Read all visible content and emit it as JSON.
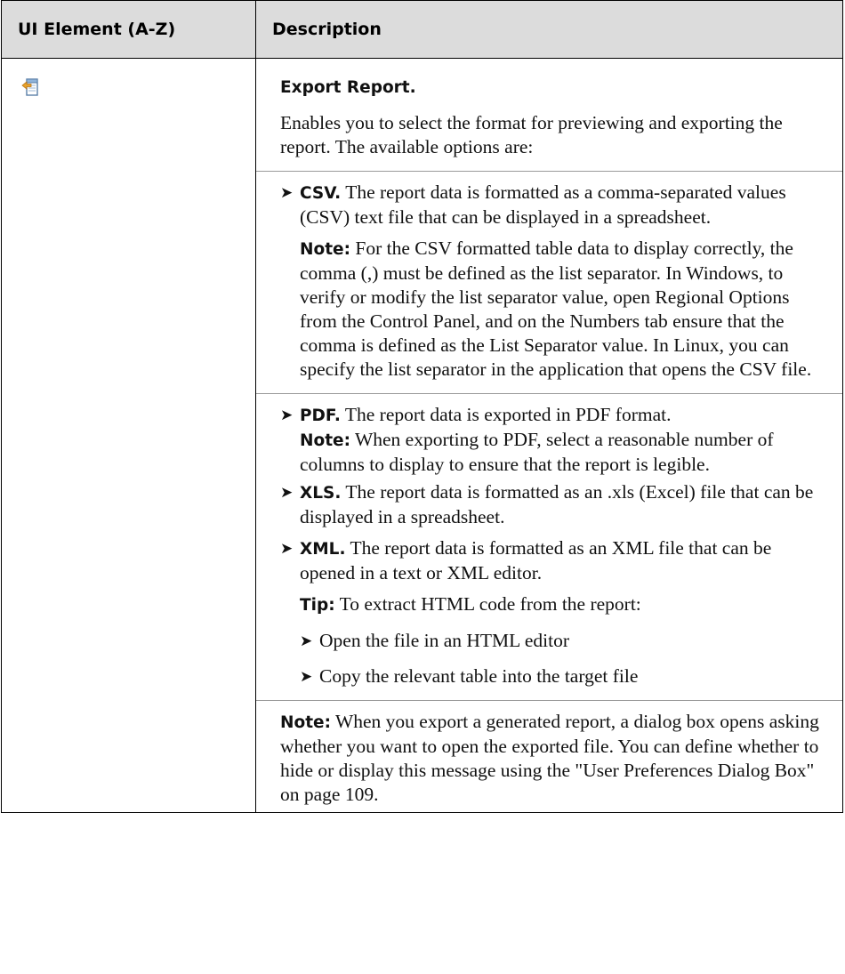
{
  "header": {
    "col1": "UI Element (A-Z)",
    "col2": "Description"
  },
  "row": {
    "icon": "export-report-icon",
    "title": "Export Report.",
    "intro": "Enables you to select the format for previewing and exporting the report. The available options are:",
    "csv_label": "CSV.",
    "csv_text": " The report data is formatted as a comma-separated values (CSV) text file that can be displayed in a spreadsheet.",
    "csv_note_label": "Note:",
    "csv_note_text": " For the CSV formatted table data to display correctly, the comma (,) must be defined as the list separator. In Windows, to verify or modify the list separator value, open Regional Options from the Control Panel, and on the Numbers tab ensure that the comma is defined as the List Separator value. In Linux, you can specify the list separator in the application that opens the CSV file.",
    "pdf_label": "PDF.",
    "pdf_text": " The report data is exported in PDF format.",
    "pdf_note_label": "Note:",
    "pdf_note_text": " When exporting to PDF, select a reasonable number of columns to display to ensure that the report is legible.",
    "xls_label": "XLS.",
    "xls_text": " The report data is formatted as an .xls (Excel) file that can be displayed in a spreadsheet.",
    "xml_label": "XML.",
    "xml_text": " The report data is formatted as an XML file that can be opened in a text or XML editor.",
    "tip_label": "Tip:",
    "tip_text": " To extract HTML code from the report:",
    "tip_steps": [
      "Open the file in an HTML editor",
      "Copy the relevant table into the target file"
    ],
    "final_note_label": "Note:",
    "final_note_text": " When you export a generated report, a dialog box opens asking whether you want to open the exported file. You can define whether to hide or display this message using the \"User Preferences Dialog Box\" on page 109."
  },
  "bullet_glyph": "➤"
}
